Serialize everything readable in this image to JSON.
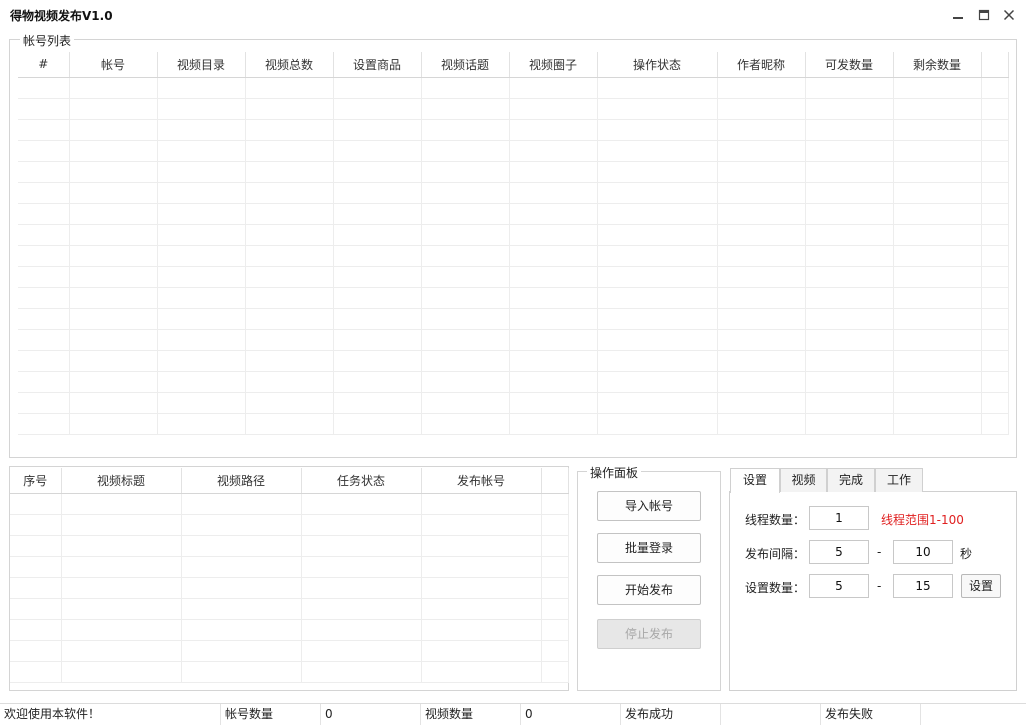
{
  "window": {
    "title": "得物视频发布V1.0"
  },
  "accounts": {
    "group_label": "帐号列表",
    "columns": [
      "#",
      "帐号",
      "视频目录",
      "视频总数",
      "设置商品",
      "视频话题",
      "视频圈子",
      "操作状态",
      "作者昵称",
      "可发数量",
      "剩余数量"
    ],
    "rows": []
  },
  "tasks": {
    "columns": [
      "序号",
      "视频标题",
      "视频路径",
      "任务状态",
      "发布帐号"
    ],
    "rows": []
  },
  "panel": {
    "label": "操作面板",
    "import_label": "导入帐号",
    "batch_login_label": "批量登录",
    "start_label": "开始发布",
    "stop_label": "停止发布"
  },
  "tabs": {
    "items": [
      "设置",
      "视频",
      "完成",
      "工作"
    ],
    "active": 0
  },
  "settings": {
    "threads_label": "线程数量：",
    "threads_value": "1",
    "threads_hint": "线程范围1-100",
    "interval_label": "发布间隔：",
    "interval_min": "5",
    "interval_dash": "-",
    "interval_max": "10",
    "interval_unit": "秒",
    "count_label": "设置数量：",
    "count_min": "5",
    "count_dash": "-",
    "count_max": "15",
    "set_label": "设置"
  },
  "status": {
    "welcome": "欢迎使用本软件！",
    "accounts_label": "帐号数量",
    "accounts_value": "0",
    "videos_label": "视频数量",
    "videos_value": "0",
    "success_label": "发布成功",
    "success_value": "",
    "fail_label": "发布失败",
    "fail_value": ""
  },
  "colors": {
    "hint": "#e02020",
    "border": "#d4d4d4"
  },
  "icons": [
    "minimize-icon",
    "maximize-icon",
    "close-icon"
  ]
}
